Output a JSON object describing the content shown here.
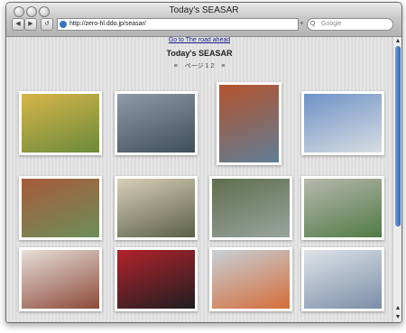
{
  "window": {
    "title": "Today's SEASAR"
  },
  "toolbar": {
    "back_label": "◀",
    "forward_label": "▶",
    "reload_label": "↺",
    "url": "http://zero-hl.ddo.jp/seasar/",
    "add_label": "+",
    "search_placeholder": "Google",
    "search_icon": "Q"
  },
  "page": {
    "top_link": "Go to The road ahead",
    "heading": "Today's SEASAR",
    "pager": {
      "prev": "≡",
      "label": "ページ 1 2",
      "next": "≡"
    }
  },
  "photos": [
    {
      "subject": "flower-pots",
      "colors": [
        "#d7b54a",
        "#6b8a3a"
      ]
    },
    {
      "subject": "shisa-statue-stone",
      "colors": [
        "#8f9aa8",
        "#3f4e5c"
      ]
    },
    {
      "subject": "shisa-statue-red",
      "colors": [
        "#b4532d",
        "#5e7d96"
      ]
    },
    {
      "subject": "shisa-on-building",
      "colors": [
        "#6f92c7",
        "#d7dde2"
      ]
    },
    {
      "subject": "shisa-at-house",
      "colors": [
        "#a85a3a",
        "#6c8f5a"
      ]
    },
    {
      "subject": "white-shisa",
      "colors": [
        "#d8cfb8",
        "#5a5f48"
      ]
    },
    {
      "subject": "shisa-garden",
      "colors": [
        "#5f6e4c",
        "#9aa4a0"
      ]
    },
    {
      "subject": "shisa-on-rock",
      "colors": [
        "#b8b8ae",
        "#4f7b45"
      ]
    },
    {
      "subject": "painted-shisa-pair",
      "colors": [
        "#e6dfd7",
        "#8d4a3a"
      ]
    },
    {
      "subject": "red-shisa-pair",
      "colors": [
        "#b2232a",
        "#1e1e22"
      ]
    },
    {
      "subject": "station-ceiling",
      "colors": [
        "#c7d0d6",
        "#d56d3a"
      ]
    },
    {
      "subject": "post-office-sign",
      "colors": [
        "#dfe3e8",
        "#7a8ea8"
      ]
    }
  ]
}
